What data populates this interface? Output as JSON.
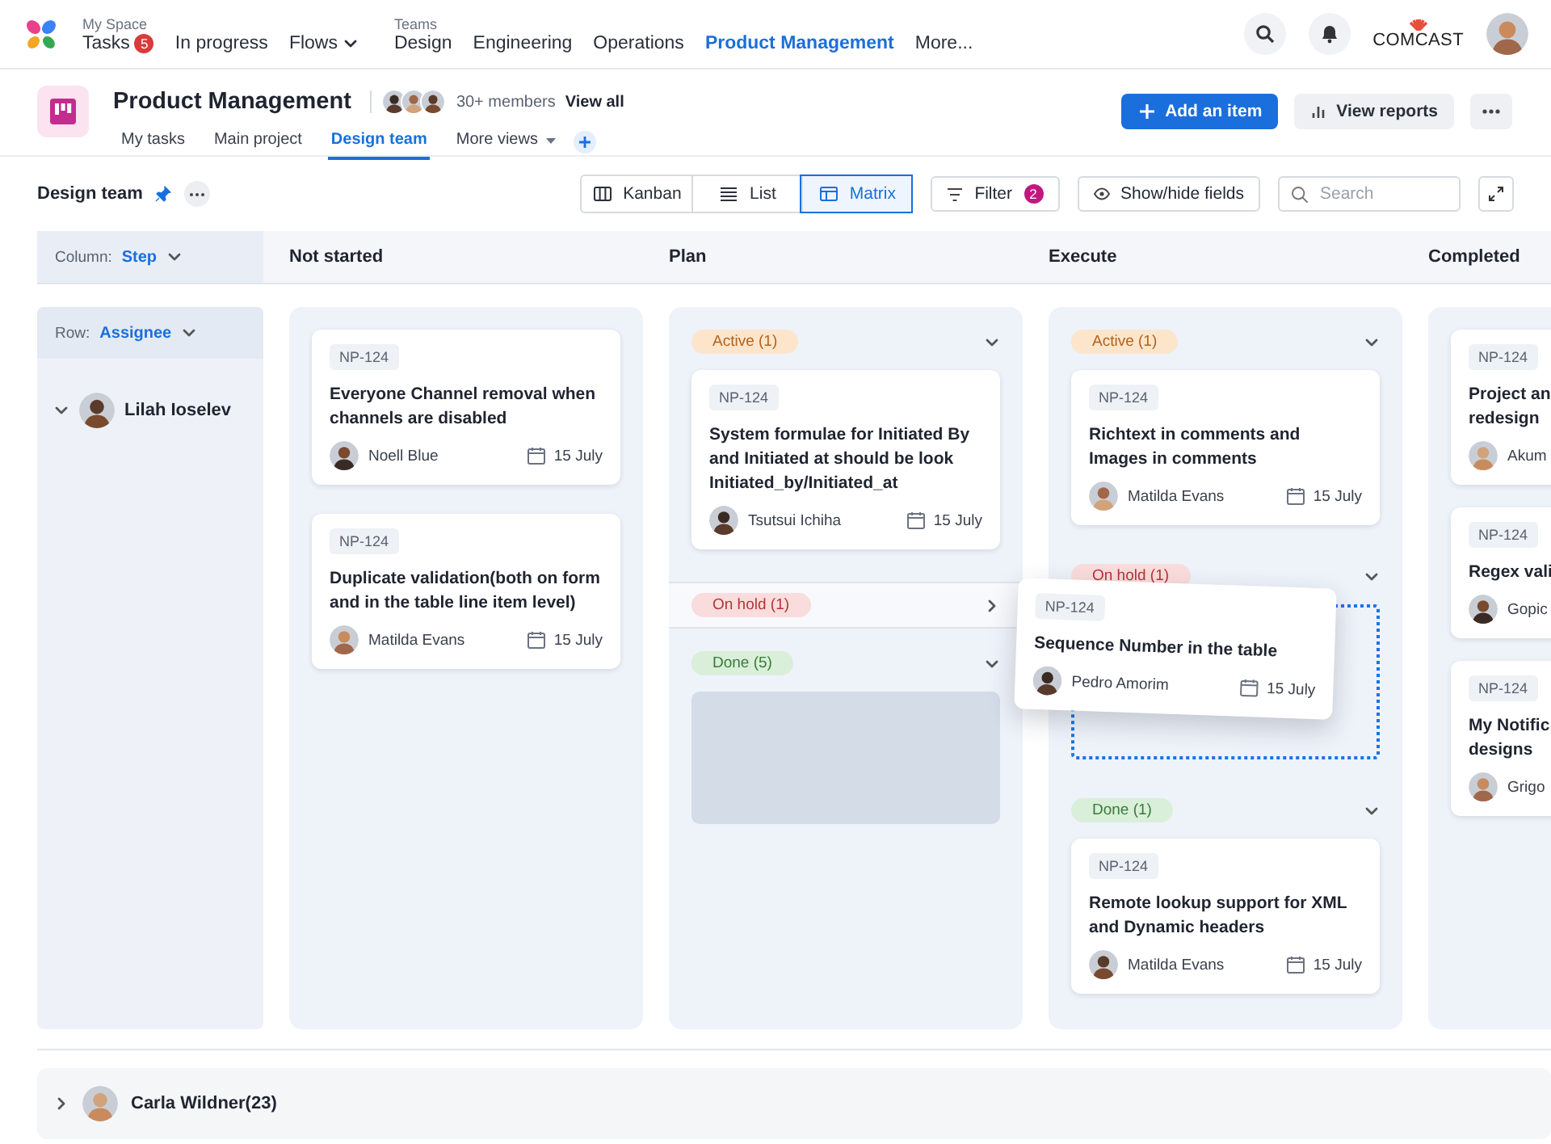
{
  "nav": {
    "groups": [
      {
        "label": "My Space",
        "items": [
          {
            "label": "Tasks",
            "badge": "5",
            "selected": false
          },
          {
            "label": "In progress",
            "selected": false
          },
          {
            "label": "Flows",
            "dropdown": true,
            "selected": false
          }
        ]
      },
      {
        "label": "Teams",
        "items": [
          {
            "label": "Design",
            "selected": false
          },
          {
            "label": "Engineering",
            "selected": false
          },
          {
            "label": "Operations",
            "selected": false
          },
          {
            "label": "Product Management",
            "selected": true
          },
          {
            "label": "More...",
            "selected": false
          }
        ]
      }
    ],
    "brand": "COMCAST"
  },
  "project": {
    "title": "Product Management",
    "members": "30+ members",
    "view_all": "View all",
    "tabs": [
      {
        "label": "My tasks",
        "selected": false
      },
      {
        "label": "Main project",
        "selected": false
      },
      {
        "label": "Design team",
        "selected": true
      },
      {
        "label": "More views",
        "dropdown": true,
        "selected": false
      }
    ],
    "actions": [
      {
        "kind": "primary",
        "label": "Add an item"
      },
      {
        "kind": "secondary",
        "label": "View reports"
      },
      {
        "kind": "more"
      }
    ]
  },
  "toolbar": {
    "view_name": "Design team",
    "pinned": true,
    "views": [
      {
        "kind": "kanban",
        "label": "Kanban",
        "selected": false
      },
      {
        "kind": "list",
        "label": "List",
        "selected": false
      },
      {
        "kind": "matrix",
        "label": "Matrix",
        "selected": true
      }
    ],
    "filter": {
      "label": "Filter",
      "count": "2"
    },
    "fields": "Show/hide fields",
    "search": {
      "placeholder": "Search"
    }
  },
  "matrix": {
    "column_by": {
      "label": "Column:",
      "value": "Step"
    },
    "row_by": {
      "label": "Row:",
      "value": "Assignee"
    },
    "columns": [
      "Not started",
      "Plan",
      "Execute",
      "Completed"
    ],
    "rows": [
      {
        "name": "Lilah Ioselev",
        "expanded": true,
        "cells": [
          {
            "cards": [
              {
                "id": "NP-124",
                "title": "Everyone Channel removal when channels are disabled",
                "assignee": "Noell Blue",
                "date": "15 July"
              },
              {
                "id": "NP-124",
                "title": "Duplicate validation(both on form and in the table line item level)",
                "assignee": "Matilda Evans",
                "date": "15 July"
              }
            ]
          },
          {
            "groups": [
              {
                "kind": "active",
                "label": "Active (1)",
                "expanded": true,
                "cards": [
                  {
                    "id": "NP-124",
                    "title": "System formulae for Initiated By and Initiated at should be look Initiated_by/Initiated_at",
                    "assignee": "Tsutsui Ichiha",
                    "date": "15 July"
                  }
                ]
              },
              {
                "kind": "hold",
                "label": "On hold (1)",
                "expanded": false
              },
              {
                "kind": "done",
                "label": "Done (5)",
                "expanded": true,
                "placeholder": true
              }
            ]
          },
          {
            "groups": [
              {
                "kind": "active",
                "label": "Active (1)",
                "expanded": true,
                "cards": [
                  {
                    "id": "NP-124",
                    "title": "Richtext in comments and Images in comments",
                    "assignee": "Matilda Evans",
                    "date": "15 July"
                  }
                ]
              },
              {
                "kind": "hold",
                "label": "On hold (1)",
                "expanded": true,
                "drop_target": true
              },
              {
                "kind": "done",
                "label": "Done (1)",
                "expanded": true,
                "cards": [
                  {
                    "id": "NP-124",
                    "title": "Remote lookup support for XML and Dynamic headers",
                    "assignee": "Matilda Evans",
                    "date": "15 July"
                  }
                ]
              }
            ]
          },
          {
            "cards": [
              {
                "id": "NP-124",
                "title": "Project an\nredesign",
                "assignee": "Akum"
              },
              {
                "id": "NP-124",
                "title": "Regex vali",
                "assignee": "Gopic"
              },
              {
                "id": "NP-124",
                "title": "My Notific\ndesigns",
                "assignee": "Grigo"
              }
            ]
          }
        ]
      },
      {
        "name": "Carla Wildner(23)",
        "expanded": false
      }
    ],
    "dragging": {
      "id": "NP-124",
      "title": "Sequence Number in the table",
      "assignee": "Pedro Amorim",
      "date": "15 July"
    }
  }
}
